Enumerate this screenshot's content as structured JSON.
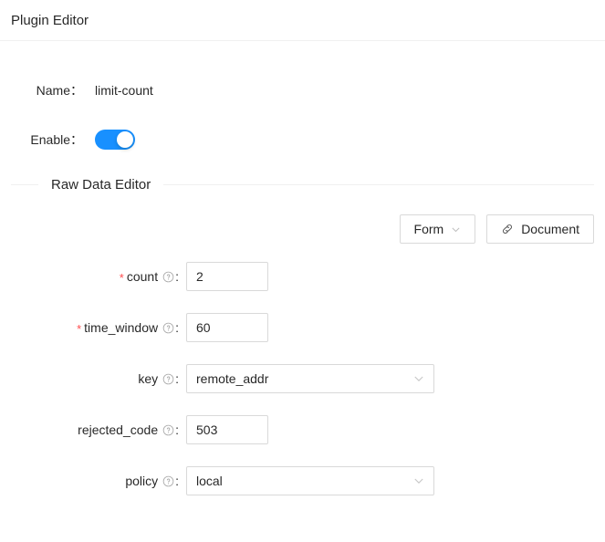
{
  "header": {
    "title": "Plugin Editor"
  },
  "meta": {
    "name_label": "Name：",
    "name_value": "limit-count",
    "enable_label": "Enable：",
    "enable_on": true
  },
  "section": {
    "divider_title": "Raw Data Editor"
  },
  "toolbar": {
    "form_label": "Form",
    "form_chevron_icon": "chevron-down-icon",
    "document_label": "Document",
    "document_icon": "link-icon"
  },
  "fields": [
    {
      "key": "count",
      "label": "count",
      "required": true,
      "help_icon": "question-circle-icon",
      "type": "input",
      "value": "2",
      "placeholder": ""
    },
    {
      "key": "time_window",
      "label": "time_window",
      "required": true,
      "help_icon": "question-circle-icon",
      "type": "input",
      "value": "60",
      "placeholder": ""
    },
    {
      "key": "key",
      "label": "key",
      "required": false,
      "help_icon": "question-circle-icon",
      "type": "select",
      "value": "remote_addr",
      "chevron_icon": "chevron-down-icon"
    },
    {
      "key": "rejected_code",
      "label": "rejected_code",
      "required": false,
      "help_icon": "question-circle-icon",
      "type": "input",
      "value": "503",
      "placeholder": ""
    },
    {
      "key": "policy",
      "label": "policy",
      "required": false,
      "help_icon": "question-circle-icon",
      "type": "select",
      "value": "local",
      "chevron_icon": "chevron-down-icon"
    }
  ],
  "colors": {
    "accent": "#1890ff",
    "required_star": "#ff4d4f",
    "border": "#d9d9d9",
    "divider": "#f0f0f0"
  }
}
